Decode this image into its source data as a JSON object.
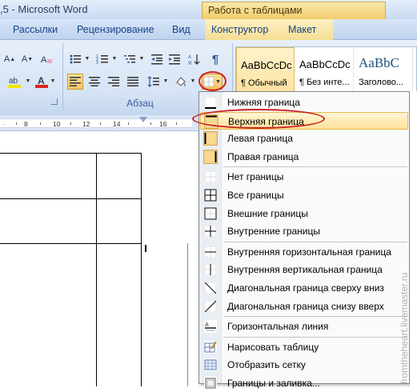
{
  "title_bar": {
    "title": ",5 - Microsoft Word",
    "context_title": "Работа с таблицами"
  },
  "tabs": {
    "mailings": "Рассылки",
    "review": "Рецензирование",
    "view": "Вид",
    "design": "Конструктор",
    "layout": "Макет"
  },
  "ribbon": {
    "paragraph_group_label": "Абзац",
    "styles": [
      {
        "sample": "AaBbCcDc",
        "name": "¶ Обычный",
        "selected": true
      },
      {
        "sample": "AaBbCcDc",
        "name": "¶ Без инте...",
        "selected": false
      },
      {
        "sample": "AaBbC",
        "name": "Заголово...",
        "selected": false
      }
    ],
    "colors": {
      "highlight": "#f2e600",
      "font_color": "#e02020"
    }
  },
  "ruler": {
    "numbers": [
      "8",
      "10",
      "12",
      "14",
      "16"
    ]
  },
  "border_menu": {
    "groups": [
      [
        {
          "label": "Нижняя граница",
          "icon": "border-bottom-icon",
          "highlighted": false,
          "active": false
        },
        {
          "label": "Верхняя граница",
          "icon": "border-top-icon",
          "highlighted": true,
          "active": true
        },
        {
          "label": "Левая граница",
          "icon": "border-left-icon",
          "highlighted": false,
          "active": true
        },
        {
          "label": "Правая граница",
          "icon": "border-right-icon",
          "highlighted": false,
          "active": true
        }
      ],
      [
        {
          "label": "Нет границы",
          "icon": "border-none-icon",
          "highlighted": false,
          "active": false
        },
        {
          "label": "Все границы",
          "icon": "border-all-icon",
          "highlighted": false,
          "active": false
        },
        {
          "label": "Внешние границы",
          "icon": "border-outside-icon",
          "highlighted": false,
          "active": false
        },
        {
          "label": "Внутренние границы",
          "icon": "border-inside-icon",
          "highlighted": false,
          "active": false
        }
      ],
      [
        {
          "label": "Внутренняя горизонтальная граница",
          "icon": "border-inside-horizontal-icon",
          "highlighted": false,
          "active": false
        },
        {
          "label": "Внутренняя вертикальная граница",
          "icon": "border-inside-vertical-icon",
          "highlighted": false,
          "active": false
        },
        {
          "label": "Диагональная граница сверху вниз",
          "icon": "border-diagonal-down-icon",
          "highlighted": false,
          "active": false
        },
        {
          "label": "Диагональная граница снизу вверх",
          "icon": "border-diagonal-up-icon",
          "highlighted": false,
          "active": false
        }
      ],
      [
        {
          "label": "Горизонтальная линия",
          "icon": "horizontal-line-icon",
          "highlighted": false,
          "active": false
        }
      ],
      [
        {
          "label": "Нарисовать таблицу",
          "icon": "draw-table-icon",
          "highlighted": false,
          "active": false
        },
        {
          "label": "Отобразить сетку",
          "icon": "view-gridlines-icon",
          "highlighted": false,
          "active": false
        },
        {
          "label": "Границы и заливка...",
          "icon": "borders-and-shading-icon",
          "highlighted": false,
          "active": false
        }
      ]
    ]
  },
  "watermark": "fromtheheart.livemaster.ru"
}
